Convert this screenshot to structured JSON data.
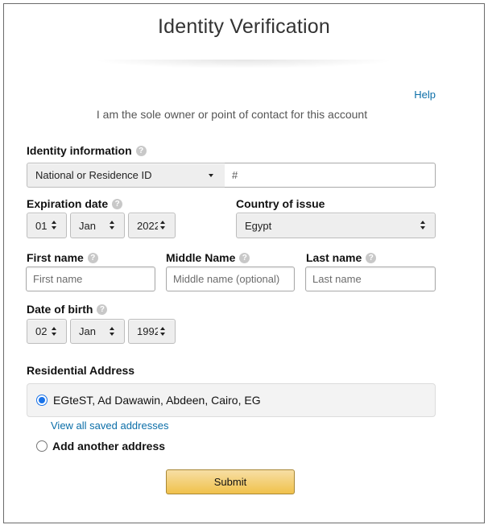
{
  "header": {
    "title": "Identity Verification",
    "help_link": "Help",
    "subtitle": "I am the sole owner or point of contact for this account"
  },
  "identity": {
    "label": "Identity information",
    "id_type": "National or Residence ID",
    "id_number_prefix": "#",
    "id_number_value": ""
  },
  "expiration": {
    "label": "Expiration date",
    "day": "01",
    "month": "Jan",
    "year": "2022"
  },
  "country": {
    "label": "Country of issue",
    "value": "Egypt"
  },
  "name": {
    "first_label": "First name",
    "first_placeholder": "First name",
    "middle_label": "Middle Name",
    "middle_placeholder": "Middle name (optional)",
    "last_label": "Last name",
    "last_placeholder": "Last name"
  },
  "dob": {
    "label": "Date of birth",
    "day": "02",
    "month": "Jan",
    "year": "1992"
  },
  "address": {
    "label": "Residential Address",
    "selected": "EGteST, Ad Dawawin, Abdeen, Cairo, EG",
    "view_all_link": "View all saved addresses",
    "add_another": "Add another address"
  },
  "submit_label": "Submit",
  "icons": {
    "info": "question-circle-icon",
    "select_arrows": "up-down-arrows-icon",
    "dropdown": "caret-down-icon",
    "radio": "radio-button"
  },
  "colors": {
    "link": "#0b6ea8",
    "submit_top": "#f7dfa5",
    "submit_bottom": "#f0c14b",
    "radio_selected": "#1a73e8"
  }
}
